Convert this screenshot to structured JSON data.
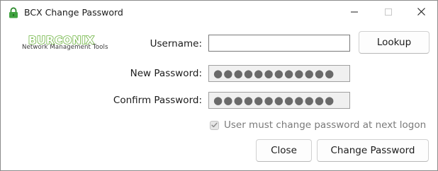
{
  "window": {
    "title": "BCX Change Password"
  },
  "logo": {
    "word": "BURCONIX",
    "tagline": "Network Management Tools",
    "brand_color": "#6cb33f"
  },
  "form": {
    "username_label": "Username:",
    "username_value": "",
    "new_password_label": "New Password:",
    "new_password_value": "●●●●●●●●●●●●",
    "confirm_password_label": "Confirm Password:",
    "confirm_password_value": "●●●●●●●●●●●●",
    "must_change_label": "User must change password at next logon",
    "must_change_checked": true,
    "must_change_disabled": true
  },
  "buttons": {
    "lookup": "Lookup",
    "close": "Close",
    "change_password": "Change Password"
  },
  "icons": {
    "title": "lock-icon",
    "minimize": "minimize-icon",
    "maximize": "maximize-icon",
    "close": "close-icon",
    "checkmark": "checkmark-icon"
  }
}
